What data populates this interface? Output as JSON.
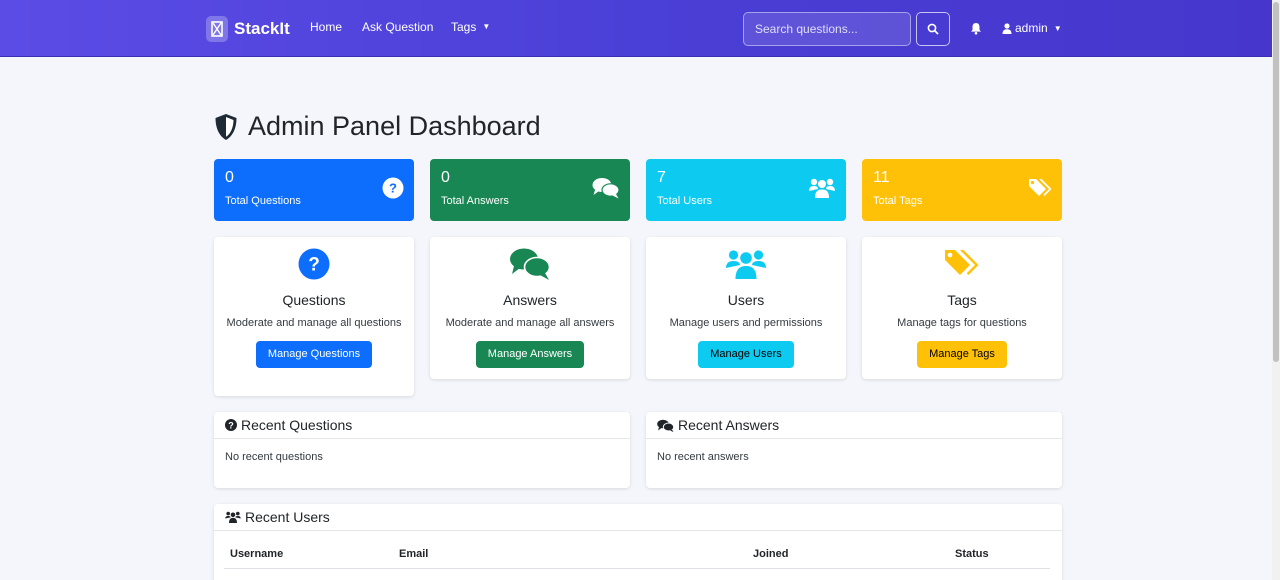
{
  "nav": {
    "brand": "StackIt",
    "links": [
      "Home",
      "Ask Question",
      "Tags"
    ],
    "search_placeholder": "Search questions...",
    "user": "admin"
  },
  "page": {
    "title": "Admin Panel Dashboard"
  },
  "stats": [
    {
      "value": "0",
      "label": "Total Questions",
      "color": "#0d6efd",
      "icon": "question-circle-icon"
    },
    {
      "value": "0",
      "label": "Total Answers",
      "color": "#198754",
      "icon": "comments-icon"
    },
    {
      "value": "7",
      "label": "Total Users",
      "color": "#0dcaf0",
      "icon": "users-icon"
    },
    {
      "value": "11",
      "label": "Total Tags",
      "color": "#ffc107",
      "icon": "tags-icon"
    }
  ],
  "modules": [
    {
      "title": "Questions",
      "desc": "Moderate and manage all questions",
      "button": "Manage Questions",
      "color": "#0d6efd"
    },
    {
      "title": "Answers",
      "desc": "Moderate and manage all answers",
      "button": "Manage Answers",
      "color": "#198754"
    },
    {
      "title": "Users",
      "desc": "Manage users and permissions",
      "button": "Manage Users",
      "color": "#0dcaf0"
    },
    {
      "title": "Tags",
      "desc": "Manage tags for questions",
      "button": "Manage Tags",
      "color": "#ffc107"
    }
  ],
  "recent_questions": {
    "title": "Recent Questions",
    "empty": "No recent questions"
  },
  "recent_answers": {
    "title": "Recent Answers",
    "empty": "No recent answers"
  },
  "recent_users": {
    "title": "Recent Users",
    "columns": [
      "Username",
      "Email",
      "Joined",
      "Status"
    ]
  }
}
